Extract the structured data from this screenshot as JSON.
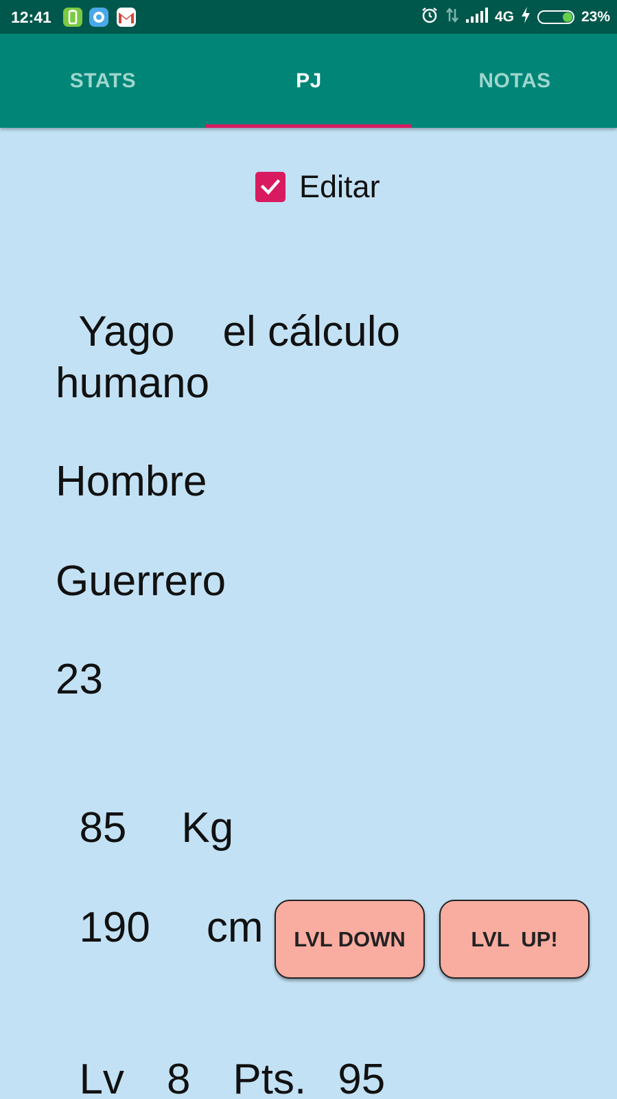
{
  "status_bar": {
    "time": "12:41",
    "network": "4G",
    "battery_percent": "23%",
    "icons": [
      "battery-app-icon",
      "chat-app-icon",
      "gmail-icon",
      "alarm-icon",
      "data-arrows-icon",
      "signal-icon",
      "charging-icon",
      "battery-icon"
    ]
  },
  "tabs": [
    {
      "label": "STATS",
      "active": false
    },
    {
      "label": "PJ",
      "active": true
    },
    {
      "label": "NOTAS",
      "active": false
    }
  ],
  "colors": {
    "app_bar": "#008577",
    "status_bar": "#00574b",
    "accent": "#d81b60",
    "background": "#c2e1f4",
    "button": "#f9aca0"
  },
  "edit": {
    "label": "Editar",
    "checked": true
  },
  "character": {
    "name": "Yago",
    "epithet": "el cálculo",
    "race": "humano",
    "gender": "Hombre",
    "class": "Guerrero",
    "age": "23",
    "weight": "85",
    "weight_unit": "Kg",
    "height": "190",
    "height_unit": "cm",
    "level_label": "Lv",
    "level": "8",
    "points_label": "Pts.",
    "points": "95"
  },
  "buttons": {
    "level_down": "LVL DOWN",
    "level_up": "LVL  UP!"
  }
}
